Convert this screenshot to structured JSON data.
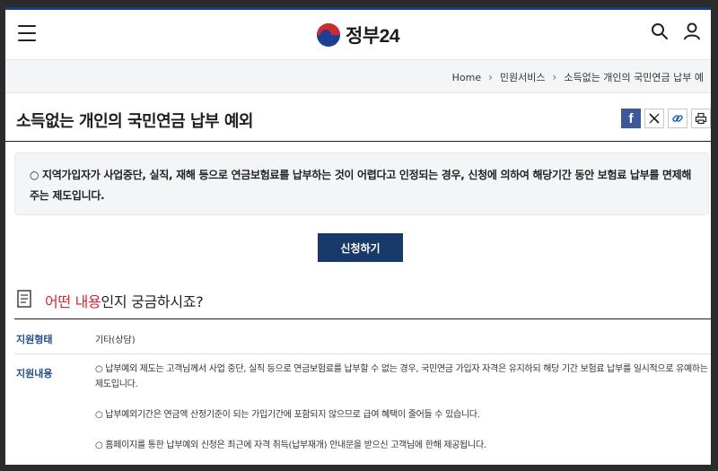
{
  "header": {
    "brand": "정부24"
  },
  "breadcrumb": {
    "items": [
      "Home",
      "민원서비스",
      "소득없는 개인의 국민연금 납부 예"
    ]
  },
  "page": {
    "title": "소득없는 개인의 국민연금 납부 예외"
  },
  "notice": {
    "text": "○ 지역가입자가 사업중단, 실직, 재해 등으로 연금보험료를 납부하는 것이 어렵다고 인정되는 경우, 신청에 의하여 해당기간 동안 보험료 납부를 면제해주는 제도입니다."
  },
  "apply_button": {
    "label": "신청하기"
  },
  "question": {
    "red": "어떤 내용",
    "rest": "인지 궁금하시죠?"
  },
  "info_table": {
    "type_label": "지원형태",
    "type_value": "기타(상담)",
    "content_label": "지원내용",
    "content_items": [
      "○ 납부예외 제도는 고객님께서 사업 중단, 실직 등으로 연금보험료를 납부할 수 없는 경우, 국민연금 가입자 자격은 유지하되 해당 기간 보험료 납부를 일시적으로 유예하는 제도입니다.",
      "○ 납부예외기간은 연금액 산정기준이 되는 가입기간에 포함되지 않으므로 급여 혜택이 줄어들 수 있습니다.",
      "○ 홈페이지를 통한 납부예외 신청은 최근에 자격 취득(납부재개) 안내문을 받으신 고객님에 한해 제공됩니다."
    ]
  },
  "icons": {
    "menu": "hamburger-icon",
    "search": "search-icon",
    "user": "user-icon",
    "facebook": "facebook-icon",
    "x": "x-icon",
    "link": "link-icon",
    "print": "print-icon",
    "document": "document-icon"
  },
  "colors": {
    "brand_blue": "#1d3f8f",
    "brand_red": "#cf2a32",
    "button_navy": "#173a6a",
    "label_blue": "#1f4e8c",
    "highlight_red": "#d8282d"
  }
}
